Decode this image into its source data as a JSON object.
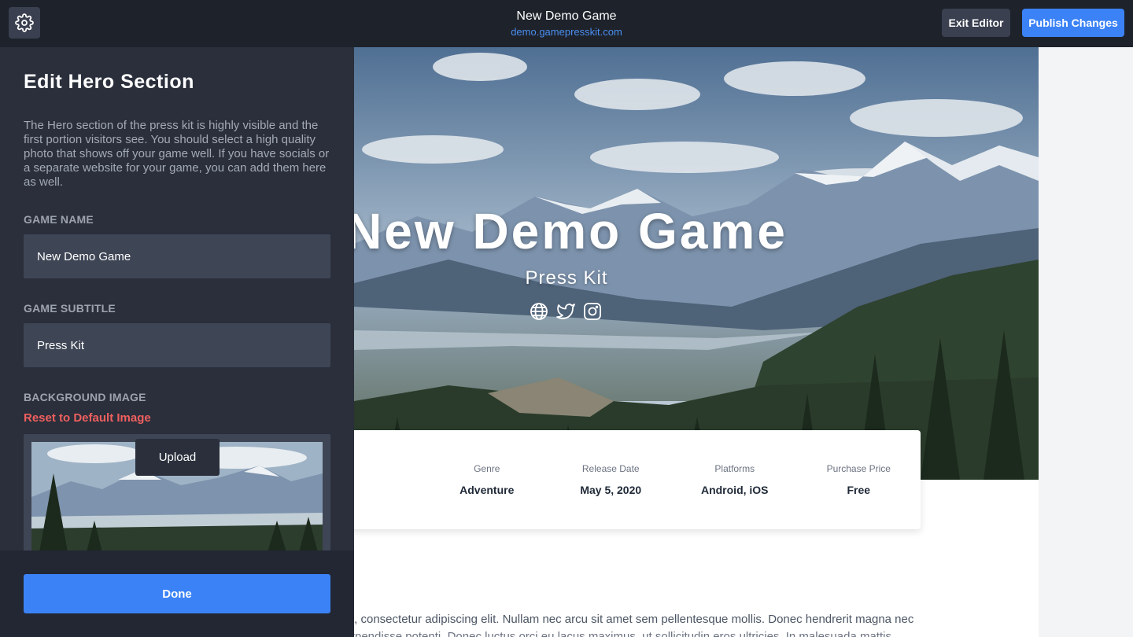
{
  "topbar": {
    "title": "New Demo Game",
    "url": "demo.gamepresskit.com",
    "exit_label": "Exit Editor",
    "publish_label": "Publish Changes",
    "settings_icon": "gear-icon"
  },
  "panel": {
    "title": "Edit Hero Section",
    "description": "The Hero section of the press kit is highly visible and the first portion visitors see. You should select a high quality photo that shows off your game well. If you have socials or a separate website for your game, you can add them here as well.",
    "game_name_label": "GAME NAME",
    "game_name_value": "New Demo Game",
    "game_subtitle_label": "GAME SUBTITLE",
    "game_subtitle_value": "Press Kit",
    "background_label": "BACKGROUND IMAGE",
    "reset_label": "Reset to Default Image",
    "upload_label": "Upload",
    "done_label": "Done"
  },
  "hero": {
    "title": "New Demo Game",
    "subtitle": "Press Kit",
    "social_icons": [
      "globe-icon",
      "twitter-icon",
      "instagram-icon"
    ]
  },
  "info": [
    {
      "label": "Genre",
      "value": "Adventure"
    },
    {
      "label": "Release Date",
      "value": "May 5, 2020"
    },
    {
      "label": "Platforms",
      "value": "Android, iOS"
    },
    {
      "label": "Purchase Price",
      "value": "Free"
    }
  ],
  "body_text": {
    "line1": "t, consectetur adipiscing elit. Nullam nec arcu sit amet sem pellentesque mollis. Donec hendrerit magna nec",
    "line2": "rpendisse potenti. Donec luctus orci eu lacus maximus, ut sollicitudin eros ultricies. In malesuada mattis"
  },
  "colors": {
    "accent": "#3b82f6",
    "danger": "#ef5f5f",
    "panel_bg": "#2a2f3b",
    "topbar_bg": "#1e222b"
  }
}
